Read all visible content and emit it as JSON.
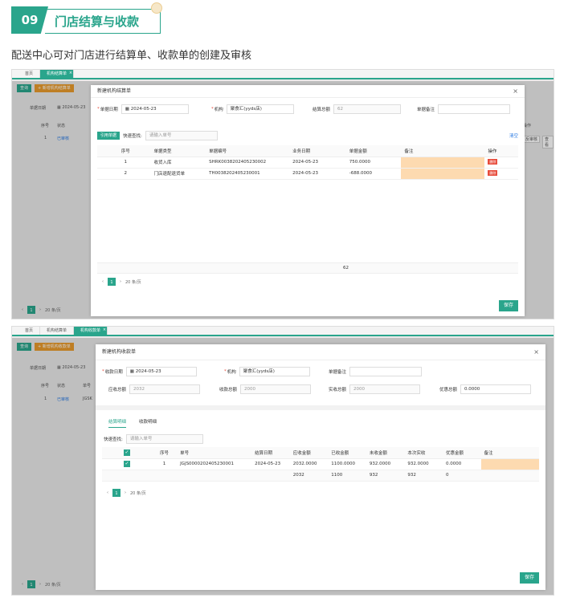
{
  "header": {
    "number": "09",
    "title": "门店结算与收款"
  },
  "subtitle": "配送中心可对门店进行结算单、收款单的创建及审核",
  "shot1": {
    "tabs": [
      "首页",
      "机构结算单"
    ],
    "bg": {
      "add_btn": "新增机构结算单",
      "filter_label": "单据日期",
      "filter_date": "2024-05-23",
      "cols": [
        "序号",
        "状态"
      ],
      "row": {
        "index": "1",
        "status": "已审核"
      },
      "op_label": "操作",
      "op_btns": [
        "反审核",
        "查看"
      ],
      "page_size": "20 条/页"
    },
    "modal": {
      "title": "新建机构结算单",
      "date_label": "单据日期",
      "date_value": "2024-05-23",
      "org_label": "机构",
      "org_value": "聚食汇(yyds店)",
      "total_label": "结算总额",
      "total_value": "62",
      "remark_label": "单据备注",
      "ref_btn": "引用单据",
      "quick_label": "快速查找:",
      "quick_placeholder": "请输入单号",
      "clear_link": "清空",
      "columns": [
        "序号",
        "单据类型",
        "单据编号",
        "业务日期",
        "单据金额",
        "备注",
        "操作"
      ],
      "rows": [
        {
          "index": "1",
          "type": "收货入库",
          "code": "SHRK0038202405230002",
          "date": "2024-05-23",
          "amount": "750.0000",
          "op": "删除"
        },
        {
          "index": "2",
          "type": "门店退配退货单",
          "code": "TH0038202405230001",
          "date": "2024-05-23",
          "amount": "-688.0000",
          "op": "删除"
        }
      ],
      "sum_amount": "62",
      "page": "1",
      "page_size": "20 条/页",
      "save": "保存"
    }
  },
  "shot2": {
    "tabs": [
      "首页",
      "机构结算单",
      "机构收款单"
    ],
    "bg": {
      "add_btn": "新增机构收款单",
      "filter_label": "单据日期",
      "filter_date": "2024-05-23",
      "cols": [
        "序号",
        "状态",
        "单号"
      ],
      "row": {
        "index": "1",
        "status": "已审核",
        "code": "JGSK"
      },
      "page_size": "20 条/页"
    },
    "modal": {
      "title": "新建机构收款单",
      "date_label": "收款日期",
      "date_value": "2024-05-23",
      "org_label": "机构",
      "org_value": "聚食汇(yyds店)",
      "remark_label": "单据备注",
      "due_label": "应收总额",
      "due_value": "2032",
      "recv_label": "收款总额",
      "recv_value": "2000",
      "actual_label": "实收总额",
      "actual_value": "2000",
      "discount_label": "优惠总额",
      "discount_value": "0.0000",
      "tab1": "结算明细",
      "tab2": "收款明细",
      "quick_label": "快速查找:",
      "quick_placeholder": "请输入单号",
      "columns": [
        "序号",
        "单号",
        "结算日期",
        "应收金额",
        "已收金额",
        "未收金额",
        "本次实收",
        "优惠金额",
        "备注"
      ],
      "row": {
        "index": "1",
        "code": "JGJS0000202405230001",
        "date": "2024-05-23",
        "due": "2032.0000",
        "received": "1100.0000",
        "unpaid": "932.0000",
        "actual": "932.0000",
        "discount": "0.0000"
      },
      "sum": {
        "due": "2032",
        "received": "1100",
        "unpaid": "932",
        "actual": "932",
        "discount": "0"
      },
      "page": "1",
      "page_size": "20 条/页",
      "save": "保存"
    }
  },
  "colors": {
    "accent": "#2aa58c",
    "peach": "#fddab0",
    "danger": "#e74c3c",
    "orange": "#e89a2c"
  }
}
